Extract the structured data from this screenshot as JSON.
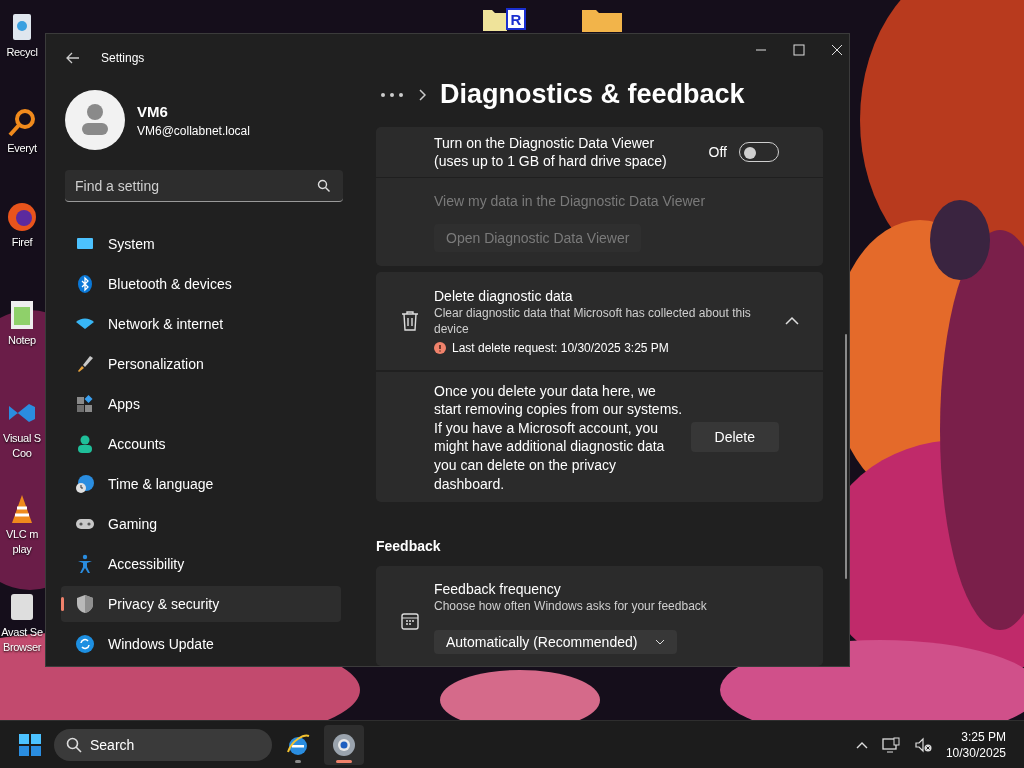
{
  "desktop_icons": [
    {
      "lines": [
        "Recycl"
      ]
    },
    {
      "lines": [
        "Everyt"
      ]
    },
    {
      "lines": [
        "Firef"
      ]
    },
    {
      "lines": [
        "Notep"
      ]
    },
    {
      "lines": [
        "Visual S",
        "Coo"
      ]
    },
    {
      "lines": [
        "VLC m",
        "play"
      ]
    },
    {
      "lines": [
        "Avast Se",
        "Browser"
      ]
    }
  ],
  "top_icons": [
    {
      "badge": "R"
    }
  ],
  "window": {
    "title": "Settings",
    "account": {
      "name": "VM6",
      "email": "VM6@collabnet.local"
    },
    "search": {
      "placeholder": "Find a setting"
    },
    "nav": [
      {
        "label": "System",
        "selected": false
      },
      {
        "label": "Bluetooth & devices",
        "selected": false
      },
      {
        "label": "Network & internet",
        "selected": false
      },
      {
        "label": "Personalization",
        "selected": false
      },
      {
        "label": "Apps",
        "selected": false
      },
      {
        "label": "Accounts",
        "selected": false
      },
      {
        "label": "Time & language",
        "selected": false
      },
      {
        "label": "Gaming",
        "selected": false
      },
      {
        "label": "Accessibility",
        "selected": false
      },
      {
        "label": "Privacy & security",
        "selected": true
      },
      {
        "label": "Windows Update",
        "selected": false
      }
    ],
    "page_title": "Diagnostics & feedback",
    "viewer_card": {
      "title": "Turn on the Diagnostic Data Viewer (uses up to 1 GB of hard drive space)",
      "toggle": {
        "label": "Off",
        "on": false
      },
      "link": {
        "label": "View my data in the Diagnostic Data Viewer",
        "disabled": true
      },
      "button": {
        "label": "Open Diagnostic Data Viewer",
        "disabled": true
      }
    },
    "delete_card": {
      "title": "Delete diagnostic data",
      "description": "Clear diagnostic data that Microsoft has collected about this device",
      "warning": "Last delete request: 10/30/2025 3:25 PM",
      "expanded": true,
      "body": "Once you delete your data here, we start removing copies from our systems. If you have a Microsoft account, you might have additional diagnostic data you can delete on the privacy dashboard.",
      "button": "Delete"
    },
    "section": "Feedback",
    "feedback_card": {
      "title": "Feedback frequency",
      "description": "Choose how often Windows asks for your feedback",
      "dropdown": "Automatically (Recommended)"
    }
  },
  "taskbar": {
    "search": "Search",
    "apps": [
      {
        "selected": false
      },
      {
        "selected": true
      }
    ],
    "clock": {
      "time": "3:25 PM",
      "date": "10/30/2025"
    }
  }
}
